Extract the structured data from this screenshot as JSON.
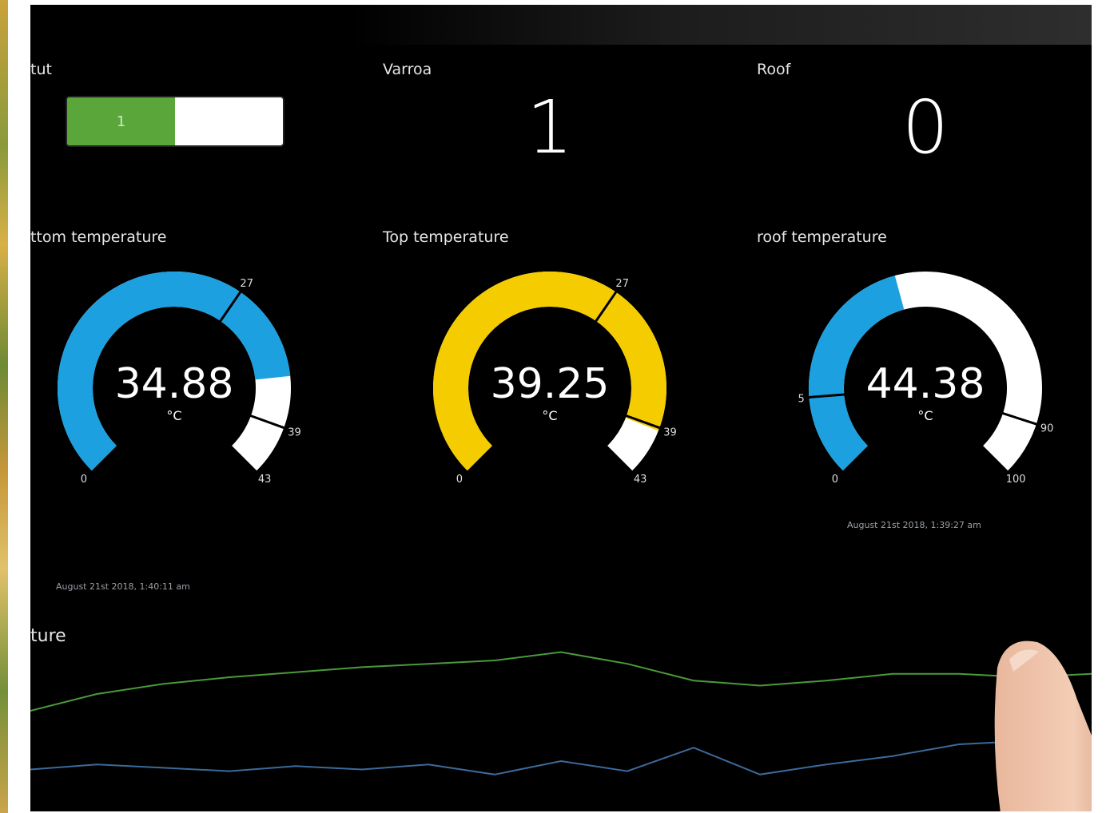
{
  "labels": {
    "status": "tut",
    "varroa": "Varroa",
    "roof": "Roof",
    "bottom_temp": "ttom temperature",
    "top_temp": "Top temperature",
    "roof_temp": "roof temperature",
    "chart_title": "ture"
  },
  "switch": {
    "value": "1",
    "fill_fraction": 0.5,
    "on_color": "#5aa63a"
  },
  "varroa_value": "1",
  "roof_value": "0",
  "gauges": [
    {
      "name": "bottom",
      "value": "34.88",
      "numeric": 34.88,
      "unit": "°C",
      "min": 0,
      "max": 43,
      "tick_mid": "27",
      "tick_hi": "39",
      "min_label": "0",
      "max_label": "43",
      "color": "#1ca0e0"
    },
    {
      "name": "top",
      "value": "39.25",
      "numeric": 39.25,
      "unit": "°C",
      "min": 0,
      "max": 43,
      "tick_mid": "27",
      "tick_hi": "39",
      "min_label": "0",
      "max_label": "43",
      "color": "#f5cc00"
    },
    {
      "name": "roof",
      "value": "44.38",
      "numeric": 44.38,
      "unit": "°C",
      "min": 0,
      "max": 100,
      "tick_low": "15",
      "tick_hi": "90",
      "min_label": "0",
      "max_label": "100",
      "color": "#1ca0e0"
    }
  ],
  "timestamps": {
    "bottom": "August 21st 2018, 1:40:11 am",
    "roof": "August 21st 2018, 1:39:27 am"
  },
  "chart_data": {
    "type": "line",
    "series": [
      {
        "color": "#4a9a3a",
        "values": [
          0.6,
          0.7,
          0.76,
          0.8,
          0.83,
          0.86,
          0.88,
          0.9,
          0.95,
          0.88,
          0.78,
          0.75,
          0.78,
          0.82,
          0.82,
          0.8,
          0.82
        ]
      },
      {
        "color": "#3b6a9a",
        "values": [
          0.25,
          0.28,
          0.26,
          0.24,
          0.27,
          0.25,
          0.28,
          0.22,
          0.3,
          0.24,
          0.38,
          0.22,
          0.28,
          0.33,
          0.4,
          0.42,
          0.4
        ]
      }
    ]
  }
}
